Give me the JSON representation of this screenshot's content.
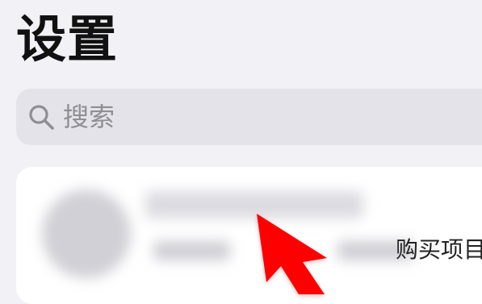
{
  "header": {
    "title": "设置"
  },
  "search": {
    "placeholder": "搜索",
    "icon": "search-icon"
  },
  "account_card": {
    "redacted": true,
    "purchase_label": "购买项目"
  },
  "annotation": {
    "type": "pointer-arrow",
    "color": "#ff0000"
  },
  "colors": {
    "background": "#f2f1f6",
    "search_background": "#e4e3e9",
    "card_background": "#ffffff",
    "placeholder": "#8e8e93",
    "arrow": "#ff0000"
  }
}
